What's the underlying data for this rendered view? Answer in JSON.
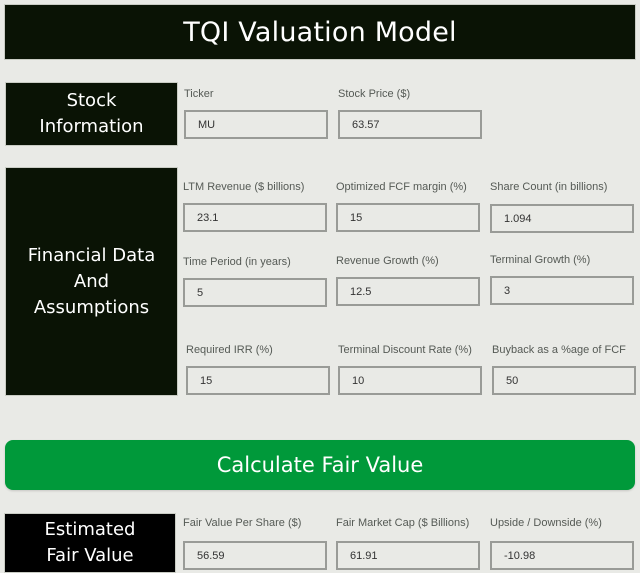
{
  "header": {
    "title": "TQI Valuation Model"
  },
  "sections": {
    "stock_info": {
      "label_line1": "Stock",
      "label_line2": "Information",
      "fields": [
        {
          "label": "Ticker",
          "value": "MU"
        },
        {
          "label": "Stock Price ($)",
          "value": "63.57"
        }
      ]
    },
    "financial": {
      "label_line1": "Financial Data",
      "label_line2": "And",
      "label_line3": "Assumptions",
      "fields": [
        {
          "label": "LTM Revenue ($ billions)",
          "value": "23.1"
        },
        {
          "label": "Optimized FCF margin (%)",
          "value": "15"
        },
        {
          "label": "Share Count (in billions)",
          "value": "1.094"
        },
        {
          "label": "Time Period (in years)",
          "value": "5"
        },
        {
          "label": "Revenue Growth (%)",
          "value": "12.5"
        },
        {
          "label": "Terminal Growth (%)",
          "value": "3"
        },
        {
          "label": "Required IRR (%)",
          "value": "15"
        },
        {
          "label": "Terminal Discount Rate (%)",
          "value": "10"
        },
        {
          "label": "Buyback as a %age of FCF",
          "value": "50"
        }
      ]
    },
    "fair_value": {
      "label_line1": "Estimated",
      "label_line2": "Fair Value",
      "fields": [
        {
          "label": "Fair Value Per Share ($)",
          "value": "56.59"
        },
        {
          "label": "Fair Market Cap ($ Billions)",
          "value": "61.91"
        },
        {
          "label": "Upside / Downside (%)",
          "value": "-10.98"
        }
      ]
    }
  },
  "actions": {
    "calculate_label": "Calculate Fair Value"
  },
  "colors": {
    "dark_panel": "#0a1305",
    "button_green": "#00993a",
    "background": "#e9eae6"
  }
}
